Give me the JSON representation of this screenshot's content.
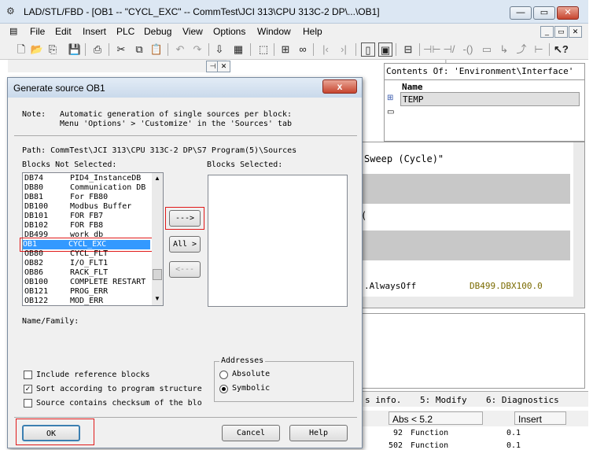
{
  "window": {
    "title": "LAD/STL/FBD  - [OB1 -- \"CYCL_EXC\" -- CommTest\\JCI 313\\CPU 313C-2 DP\\...\\OB1]",
    "minimize": "—",
    "maximize": "▭",
    "close": "✕"
  },
  "menu": [
    "File",
    "Edit",
    "Insert",
    "PLC",
    "Debug",
    "View",
    "Options",
    "Window",
    "Help"
  ],
  "toolbar_icons": [
    "new-icon",
    "open-icon",
    "network-icon",
    "save-icon",
    "print-icon",
    "cut-icon",
    "copy-icon",
    "paste-icon",
    "undo-icon",
    "redo-icon",
    "load-icon",
    "monitor-icon",
    "select-icon",
    "network2-icon",
    "glasses-icon",
    "jump-back-icon",
    "jump-fwd-icon",
    "overview-icon",
    "details-icon",
    "block-icon",
    "contact-no-icon",
    "contact-nc-icon",
    "coil-icon",
    "box-icon",
    "branch-open-icon",
    "branch-close-icon",
    "connection-icon",
    "help-icon"
  ],
  "env": {
    "header": "Contents Of: 'Environment\\Interface'",
    "col_name": "Name",
    "row1": "TEMP"
  },
  "code": {
    "sweep": "Sweep (Cycle)\"",
    "bracket": "(",
    "always_off": ".AlwaysOff",
    "address": "DB499.DBX100.0"
  },
  "tabs": [
    "s info.",
    "5: Modify",
    "6: Diagnostics"
  ],
  "status": {
    "abs": "Abs < 5.2",
    "mode": "Insert"
  },
  "bottom_rows": [
    {
      "n": "92",
      "t": "Function",
      "v": "0.1"
    },
    {
      "n": "502",
      "t": "Function",
      "v": "0.1"
    }
  ],
  "dialog": {
    "title": "Generate source OB1",
    "close": "x",
    "note_label": "Note:",
    "note_line1": "Automatic generation of single sources per block:",
    "note_line2": "Menu 'Options' > 'Customize' in the 'Sources' tab",
    "path": "Path: CommTest\\JCI 313\\CPU 313C-2 DP\\S7 Program(5)\\Sources",
    "not_selected_label": "Blocks Not Selected:",
    "selected_label": "Blocks Selected:",
    "blocks": [
      {
        "id": "DB74",
        "name": "PID4_InstanceDB"
      },
      {
        "id": "DB80",
        "name": "Communication DB"
      },
      {
        "id": "DB81",
        "name": "For FB80"
      },
      {
        "id": "DB100",
        "name": "Modbus Buffer"
      },
      {
        "id": "DB101",
        "name": "FOR FB7"
      },
      {
        "id": "DB102",
        "name": "FOR FB8"
      },
      {
        "id": "DB499",
        "name": "work db"
      },
      {
        "id": "OB1",
        "name": "CYCL_EXC"
      },
      {
        "id": "OB80",
        "name": "CYCL_FLT"
      },
      {
        "id": "OB82",
        "name": "I/O_FLT1"
      },
      {
        "id": "OB86",
        "name": "RACK_FLT"
      },
      {
        "id": "OB100",
        "name": "COMPLETE RESTART"
      },
      {
        "id": "OB121",
        "name": "PROG_ERR"
      },
      {
        "id": "OB122",
        "name": "MOD_ERR"
      }
    ],
    "selected_index": 7,
    "btn_add": "--->",
    "btn_all": "All >",
    "btn_remove": "<---",
    "name_family": "Name/Family:",
    "addresses_label": "Addresses",
    "absolute": "Absolute",
    "symbolic": "Symbolic",
    "include_ref": "Include reference blocks",
    "sort": "Sort according to program structure",
    "checksum": "Source contains checksum of the blo",
    "ok": "OK",
    "cancel": "Cancel",
    "help": "Help"
  }
}
